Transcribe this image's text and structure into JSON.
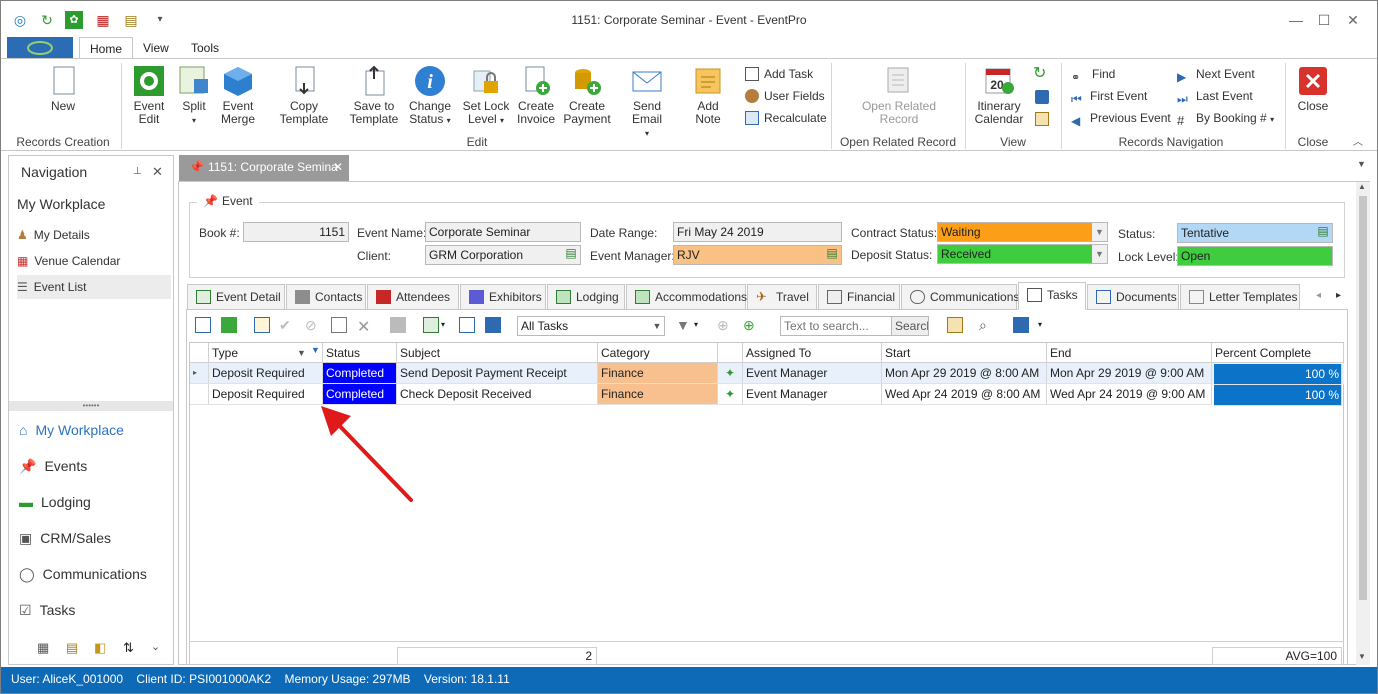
{
  "window": {
    "title": "1151: Corporate Seminar - Event - EventPro"
  },
  "ribbon_tabs": [
    "Home",
    "View",
    "Tools"
  ],
  "ribbon": {
    "new_label": "New",
    "records_creation": "Records Creation",
    "event_edit": [
      "Event",
      "Edit"
    ],
    "split": "Split",
    "event_merge": [
      "Event",
      "Merge"
    ],
    "copy_template": "Copy Template",
    "save_to_template": [
      "Save to",
      "Template"
    ],
    "change_status": [
      "Change",
      "Status"
    ],
    "set_lock_level": [
      "Set Lock",
      "Level"
    ],
    "create_invoice": [
      "Create",
      "Invoice"
    ],
    "create_payment": [
      "Create",
      "Payment"
    ],
    "send_email": "Send Email",
    "add_note": "Add Note",
    "add_task": "Add Task",
    "user_fields": "User Fields",
    "recalculate": "Recalculate",
    "edit_group": "Edit",
    "open_related_record": [
      "Open Related",
      "Record"
    ],
    "open_related_group": "Open Related Record",
    "itinerary_calendar": [
      "Itinerary",
      "Calendar"
    ],
    "view_group": "View",
    "find": "Find",
    "first_event": "First Event",
    "previous_event": "Previous Event",
    "next_event": "Next Event",
    "last_event": "Last Event",
    "by_booking": "By Booking #",
    "records_navigation": "Records Navigation",
    "close_label": "Close",
    "close_group": "Close"
  },
  "navigation": {
    "title": "Navigation",
    "section": "My Workplace",
    "links": [
      "My Details",
      "Venue Calendar",
      "Event List"
    ],
    "modules": [
      "My Workplace",
      "Events",
      "Lodging",
      "CRM/Sales",
      "Communications",
      "Tasks"
    ]
  },
  "doc_tab": "1151: Corporate Semina",
  "event": {
    "group_label": "Event",
    "book_label": "Book #:",
    "book_value": "1151",
    "name_label": "Event Name:",
    "name_value": "Corporate Seminar",
    "client_label": "Client:",
    "client_value": "GRM Corporation",
    "date_label": "Date Range:",
    "date_value": "Fri May 24 2019",
    "manager_label": "Event Manager:",
    "manager_value": "RJV",
    "contract_label": "Contract Status:",
    "contract_value": "Waiting",
    "deposit_label": "Deposit Status:",
    "deposit_value": "Received",
    "status_label": "Status:",
    "status_value": "Tentative",
    "lock_label": "Lock Level:",
    "lock_value": "Open"
  },
  "detail_tabs": [
    "Event Detail",
    "Contacts",
    "Attendees",
    "Exhibitors",
    "Lodging",
    "Accommodations",
    "Travel",
    "Financial",
    "Communications",
    "Tasks",
    "Documents",
    "Letter Templates"
  ],
  "toolbar": {
    "filter_value": "All Tasks",
    "search_placeholder": "Text to search...",
    "search_button": "Search"
  },
  "grid": {
    "columns": [
      "Type",
      "Status",
      "Subject",
      "Category",
      "",
      "Assigned To",
      "Start",
      "End",
      "Percent Complete"
    ],
    "rows": [
      [
        "Deposit Required",
        "Completed",
        "Send Deposit Payment Receipt",
        "Finance",
        "✦",
        "Event Manager",
        "Mon Apr 29 2019 @ 8:00 AM",
        "Mon Apr 29 2019 @ 9:00 AM",
        "100 %"
      ],
      [
        "Deposit Required",
        "Completed",
        "Check Deposit Received",
        "Finance",
        "✦",
        "Event Manager",
        "Wed Apr 24 2019 @ 8:00 AM",
        "Wed Apr 24 2019 @ 9:00 AM",
        "100 %"
      ]
    ],
    "footer_count": "2",
    "footer_avg": "AVG=100"
  },
  "status_bar": {
    "user": "User: AliceK_001000",
    "client_id": "Client ID: PSI001000AK2",
    "memory": "Memory Usage: 297MB",
    "version": "Version: 18.1.11"
  },
  "colors": {
    "accent": "#0e6ab7",
    "completed": "#0000ff",
    "finance": "#f9c08f",
    "waiting": "#fc9e18",
    "received": "#3fcc3f",
    "tentative": "#b3d8f5",
    "manager": "#fac184",
    "percent_bar": "#0b74c8",
    "arrow": "#e01a1a"
  }
}
